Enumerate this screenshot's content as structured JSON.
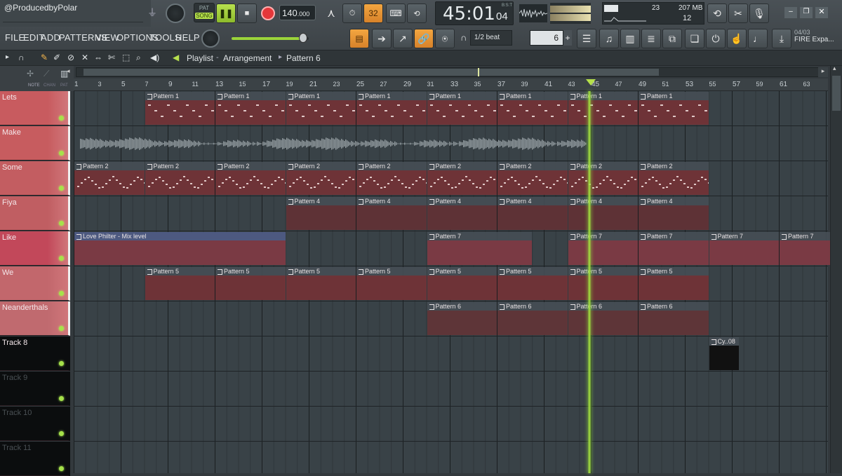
{
  "app": {
    "watermark": "@ProducedbyPolar"
  },
  "transport": {
    "mode": "SONG",
    "pat": "PAT",
    "tempo": "140",
    "tempo_decimals": ".000",
    "time": "45:01",
    "ticks": "04",
    "time_label": "B:S:T",
    "snap_number": "32"
  },
  "monitor": {
    "cpu": "23",
    "memory": "207 MB",
    "poly": "12"
  },
  "menu": [
    "FILE",
    "EDIT",
    "ADD",
    "PATTERNS",
    "VIEW",
    "OPTIONS",
    "TOOLS",
    "HELP"
  ],
  "snap": {
    "value": "1/2 beat",
    "pattern_number": "6"
  },
  "news": {
    "date": "04/03",
    "label": "FIRE Expa..."
  },
  "breadcrumb": {
    "root": "Playlist",
    "part1": "Arrangement",
    "part2": "Pattern 6"
  },
  "ruler_labels": {
    "left": [
      "NOTE",
      "CHAN",
      "PAT"
    ]
  },
  "ruler_ticks": [
    "1",
    "3",
    "5",
    "7",
    "9",
    "11",
    "13",
    "15",
    "17",
    "19",
    "21",
    "23",
    "25",
    "27",
    "29",
    "31",
    "33",
    "35",
    "37",
    "39",
    "41",
    "43",
    "45",
    "47",
    "49",
    "51",
    "53",
    "55",
    "57",
    "59",
    "61",
    "63"
  ],
  "tracks": [
    {
      "name": "Lets",
      "color": "#c85b5f"
    },
    {
      "name": "Make",
      "color": "#c75c5f"
    },
    {
      "name": "Some",
      "color": "#c35d61"
    },
    {
      "name": "Fiya",
      "color": "#c05e62"
    },
    {
      "name": "Like",
      "color": "#c2485a"
    },
    {
      "name": "We",
      "color": "#c2676c"
    },
    {
      "name": "Neanderthals",
      "color": "#c06a6f"
    },
    {
      "name": "Track 8",
      "color": "#0b0d0e"
    },
    {
      "name": "Track 9",
      "color": "#0b0d0e"
    },
    {
      "name": "Track 10",
      "color": "#0b0d0e"
    },
    {
      "name": "Track 11",
      "color": "#0b0d0e"
    }
  ],
  "clip_labels": {
    "p1": "Pattern 1",
    "p2": "Pattern 2",
    "p4": "Pattern 4",
    "p5": "Pattern 5",
    "p6": "Pattern 6",
    "p7": "Pattern 7",
    "auto": "Love Philter - Mix level",
    "cy": "Cy..08"
  },
  "colors": {
    "accent": "#f0a03a",
    "clip_red": "#7a3438",
    "playhead": "#a5e23d"
  }
}
